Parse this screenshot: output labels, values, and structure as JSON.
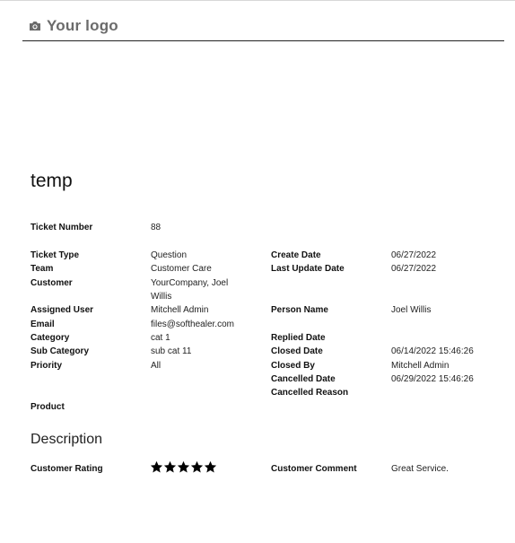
{
  "header": {
    "logo_text": "Your logo",
    "logo_icon": "camera-icon"
  },
  "ticket": {
    "title": "temp"
  },
  "fields": {
    "ticket_number_label": "Ticket Number",
    "ticket_number": "88",
    "ticket_type_label": "Ticket Type",
    "ticket_type": "Question",
    "team_label": "Team",
    "team": "Customer Care",
    "customer_label": "Customer",
    "customer": "YourCompany, Joel Willis",
    "create_date_label": "Create Date",
    "create_date": "06/27/2022",
    "last_update_label": "Last Update Date",
    "last_update": "06/27/2022",
    "assigned_user_label": "Assigned User",
    "assigned_user": "Mitchell Admin",
    "email_label": "Email",
    "email": "files@softhealer.com",
    "category_label": "Category",
    "category": "cat 1",
    "sub_category_label": "Sub Category",
    "sub_category": "sub cat 11",
    "priority_label": "Priority",
    "priority": "All",
    "person_name_label": "Person Name",
    "person_name": "Joel Willis",
    "replied_date_label": "Replied Date",
    "replied_date": "",
    "closed_date_label": "Closed Date",
    "closed_date": "06/14/2022 15:46:26",
    "closed_by_label": "Closed By",
    "closed_by": "Mitchell Admin",
    "cancelled_date_label": "Cancelled Date",
    "cancelled_date": "06/29/2022 15:46:26",
    "cancelled_reason_label": "Cancelled Reason",
    "cancelled_reason": "",
    "product_label": "Product",
    "product": ""
  },
  "description": {
    "title": "Description",
    "customer_rating_label": "Customer Rating",
    "customer_rating": 5,
    "customer_rating_max": 5,
    "customer_comment_label": "Customer Comment",
    "customer_comment": "Great Service."
  }
}
